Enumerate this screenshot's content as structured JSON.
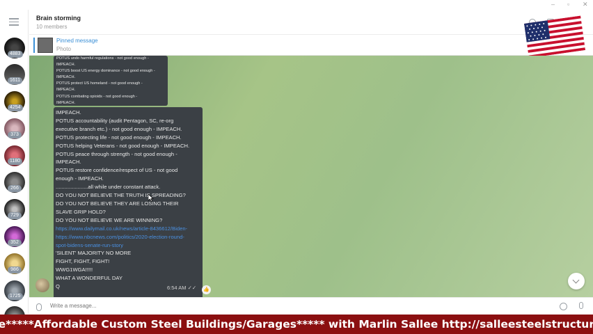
{
  "chat": {
    "title": "Brain storming",
    "subtitle": "10 members",
    "pinned": {
      "title": "Pinned message",
      "subtitle": "Photo"
    }
  },
  "sidebar": {
    "badges": [
      "4883",
      "1611",
      "4254",
      "373",
      "1180",
      "266",
      "729",
      "352",
      "986",
      "1725"
    ]
  },
  "messages": {
    "bubble1_lines": [
      "POTUS undo harmful regulations - not good enough -",
      "IMPEACH.",
      "POTUS boost US energy dominance - not good enough -",
      "IMPEACH.",
      "POTUS protect US homeland - not good enough -",
      "IMPEACH.",
      "POTUS combating opioids - not good enough -",
      "IMPEACH."
    ],
    "bubble2_lines_a": [
      "IMPEACH.",
      "POTUS accountability (audit Pentagon, SC, re-org",
      "executive branch etc.) - not good enough - IMPEACH.",
      "POTUS protecting life - not good enough - IMPEACH.",
      "POTUS helping Veterans - not good enough - IMPEACH.",
      "POTUS peace through strength - not good enough -",
      "IMPEACH.",
      "POTUS restore confidence/respect of US - not good",
      "enough - IMPEACH.",
      "......................all while under constant attack.",
      "DO YOU NOT BELIEVE THE TRUTH IS SPREADING?",
      "DO YOU NOT BELIEVE THEY ARE LOSING THEIR",
      "SLAVE GRIP HOLD?",
      "DO YOU NOT BELIEVE WE ARE WINNING?"
    ],
    "link_lines": [
      "https://www.dailymail.co.uk/news/article-8436612/Biden-",
      "https://www.nbcnews.com/politics/2020-election-round-",
      "spot-bidens-senate-run-story"
    ],
    "bubble2_lines_b": [
      "'SILENT' MAJORITY NO MORE",
      "FIGHT, FIGHT, FIGHT!",
      "WWG1WGA!!!!!",
      "WHAT A WONDERFUL DAY",
      "Q"
    ],
    "time": "6:54 AM"
  },
  "composer": {
    "placeholder": "Write a message..."
  },
  "ticker": {
    "text": "re*****Affordable Custom Steel Buildings/Garages***** with Marlin Sallee http://salleesteelstructures.com"
  },
  "colors": {
    "bubble": "#3b4045",
    "link": "#4a90e2",
    "ticker_bg": "#8b0f10",
    "accent": "#3a8fd6"
  }
}
